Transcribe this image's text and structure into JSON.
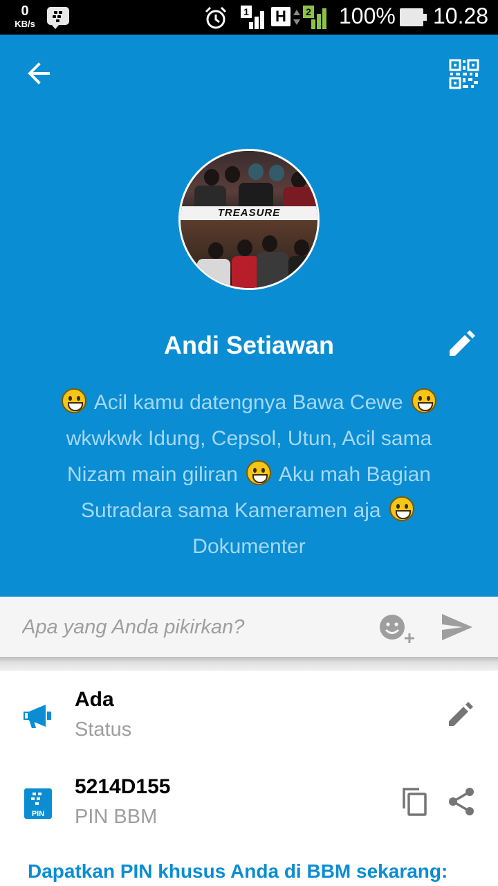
{
  "status_bar": {
    "speed_value": "0",
    "speed_unit": "KB/s",
    "sim1_label": "1",
    "network_type": "H",
    "sim2_label": "2",
    "battery_percent": "100%",
    "battery_level": 1.0,
    "time": "10.28"
  },
  "profile": {
    "avatar_text": "TREASURE",
    "name": "Andi Setiawan",
    "status_message": {
      "part1": "Acil kamu datengnya Bawa Cewe",
      "part2": "wkwkwk Idung, Cepsol, Utun, Acil sama Nizam main giliran",
      "part3": "Aku mah Bagian Sutradara sama Kameramen aja",
      "part4": "Dokumenter"
    }
  },
  "composer": {
    "placeholder": "Apa yang Anda pikirkan?"
  },
  "status_row": {
    "title": "Ada",
    "subtitle": "Status"
  },
  "pin_row": {
    "icon_label": "PIN",
    "title": "5214D155",
    "subtitle": "PIN BBM"
  },
  "promo": {
    "link_text": "Dapatkan PIN khusus Anda di BBM sekarang:"
  },
  "colors": {
    "header_bg": "#0a8dd3",
    "status_text": "#a6d8f3",
    "link": "#0a8dd3",
    "signal_green": "#8bc34a"
  },
  "icons": {
    "back": "arrow-left-icon",
    "qr": "qr-code-icon",
    "edit": "pencil-icon",
    "emoji_add": "emoji-add-icon",
    "send": "send-icon",
    "status": "megaphone-icon",
    "pin": "bbm-pin-icon",
    "copy": "copy-icon",
    "share": "share-icon"
  }
}
